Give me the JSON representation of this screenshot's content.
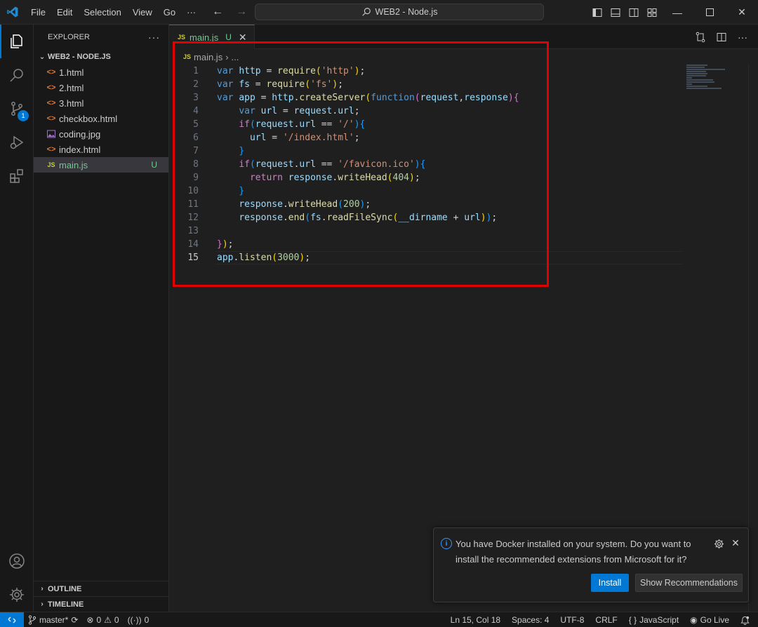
{
  "titlebar": {
    "menu": [
      "File",
      "Edit",
      "Selection",
      "View",
      "Go",
      "···"
    ],
    "search_text": "WEB2 - Node.js"
  },
  "activity": {
    "source_control_badge": "1"
  },
  "sidebar": {
    "title": "EXPLORER",
    "more": "···",
    "folder": "WEB2 - NODE.JS",
    "files": [
      {
        "name": "1.html",
        "type": "html"
      },
      {
        "name": "2.html",
        "type": "html"
      },
      {
        "name": "3.html",
        "type": "html"
      },
      {
        "name": "checkbox.html",
        "type": "html"
      },
      {
        "name": "coding.jpg",
        "type": "image"
      },
      {
        "name": "index.html",
        "type": "html"
      },
      {
        "name": "main.js",
        "type": "js",
        "status": "U"
      }
    ],
    "outline": "OUTLINE",
    "timeline": "TIMELINE"
  },
  "editor": {
    "tab": {
      "name": "main.js",
      "status": "U",
      "icon": "JS"
    },
    "breadcrumb": {
      "file": "main.js",
      "rest": "..."
    },
    "lines": [
      "1",
      "2",
      "3",
      "4",
      "5",
      "6",
      "7",
      "8",
      "9",
      "10",
      "11",
      "12",
      "13",
      "14",
      "15"
    ],
    "current_line": "15"
  },
  "notification": {
    "message": "You have Docker installed on your system. Do you want to install the recommended extensions from Microsoft for it?",
    "install": "Install",
    "show": "Show Recommendations"
  },
  "statusbar": {
    "branch": "master*",
    "errors": "0",
    "warnings": "0",
    "ports": "0",
    "position": "Ln 15, Col 18",
    "spaces": "Spaces: 4",
    "encoding": "UTF-8",
    "eol": "CRLF",
    "language": "JavaScript",
    "golive": "Go Live"
  },
  "colors": {
    "accent": "#0078d4",
    "highlight_box": "#e30000",
    "untracked": "#73c991"
  }
}
